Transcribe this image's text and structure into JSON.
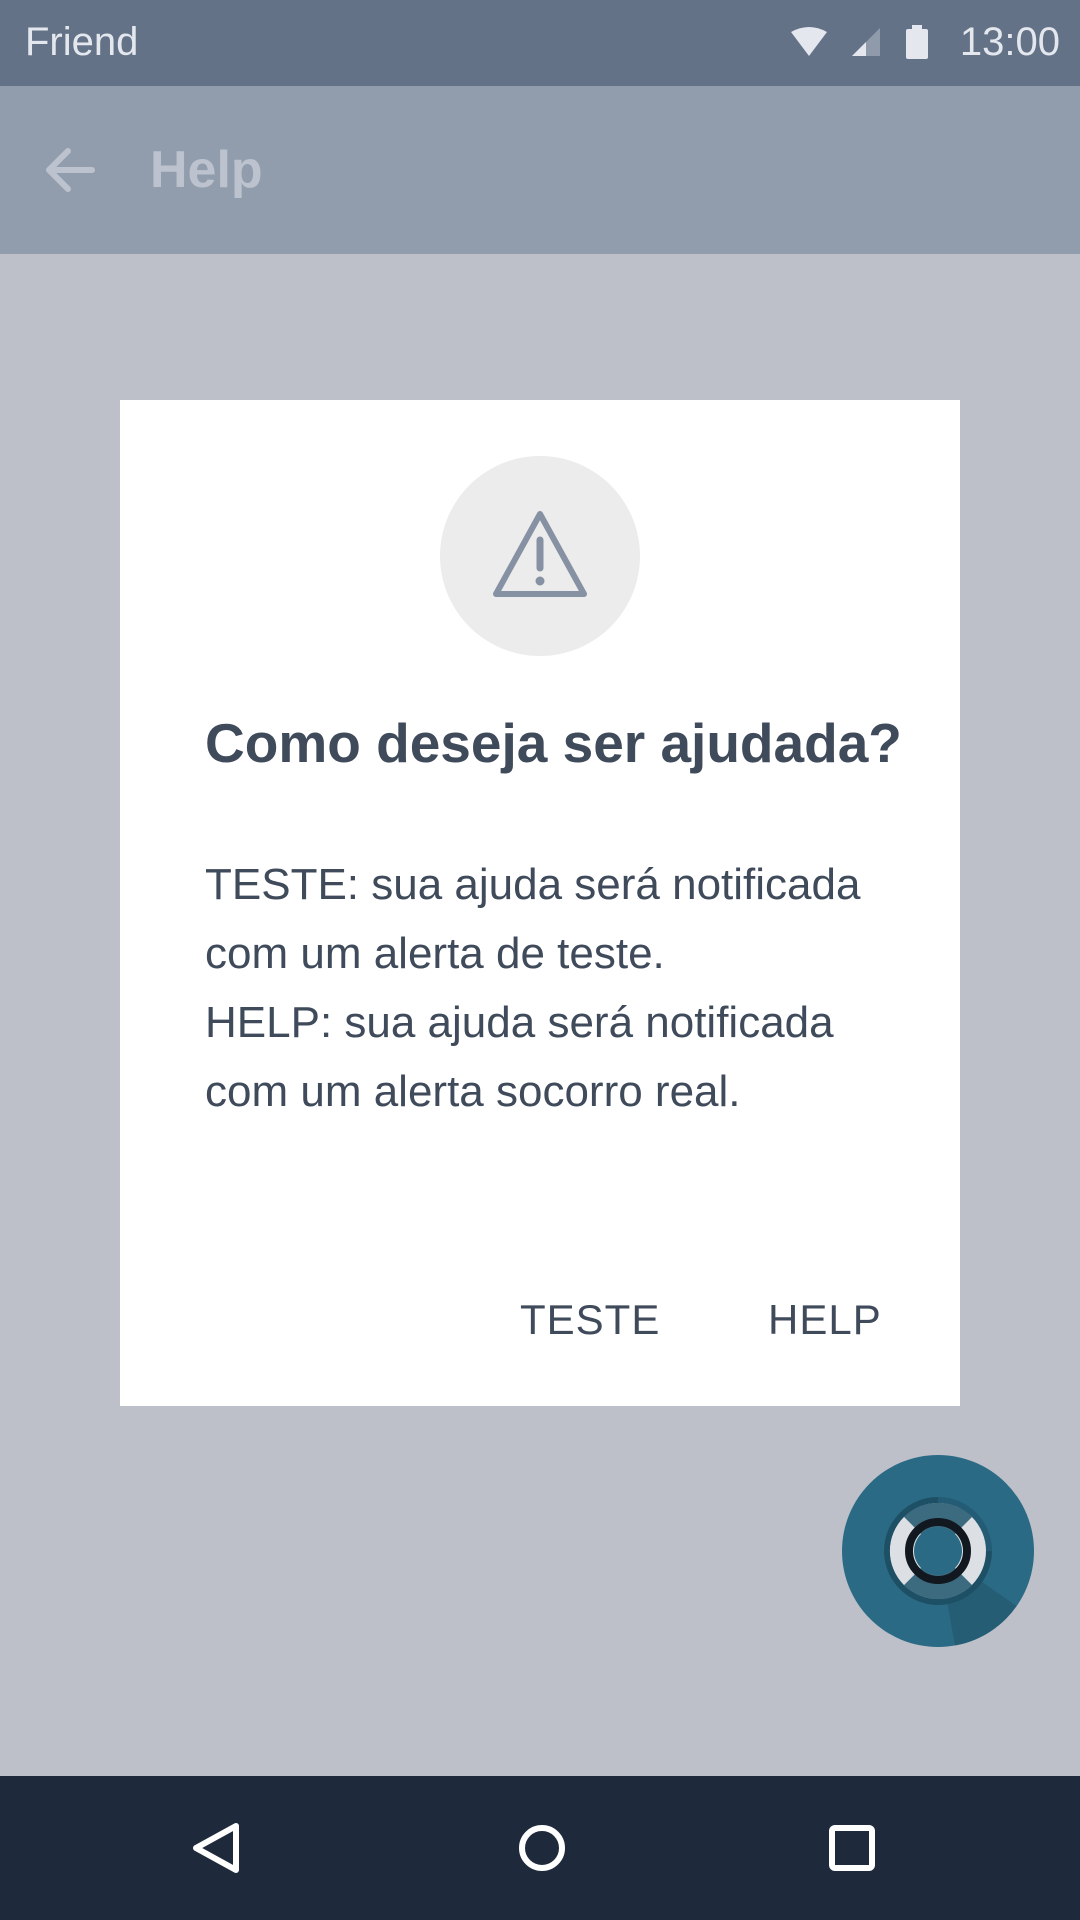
{
  "status_bar": {
    "app_name": "Friend",
    "time": "13:00",
    "icons": [
      "wifi-icon",
      "signal-icon",
      "battery-icon"
    ]
  },
  "app_bar": {
    "back_icon": "arrow-left-icon",
    "title": "Help"
  },
  "dialog": {
    "icon": "warning-triangle-icon",
    "title": "Como deseja ser ajudada?",
    "body_line_1": "TESTE: sua ajuda será notificada com um alerta de teste.",
    "body_line_2": "HELP: sua ajuda será notificada com um alerta socorro real.",
    "actions": {
      "teste_label": "TESTE",
      "help_label": "HELP"
    }
  },
  "fab": {
    "icon": "lifebuoy-icon"
  },
  "navigation_bar": {
    "icons": [
      "nav-back-icon",
      "nav-home-icon",
      "nav-recents-icon"
    ]
  },
  "colors": {
    "status_bar": "#637287",
    "app_bar": "#919dac",
    "scrim": "#bdc0c9",
    "dialog_background": "#ffffff",
    "text": "#3f4a5a",
    "fab": "#2b6a85",
    "nav_bar": "#1e2a3b"
  }
}
